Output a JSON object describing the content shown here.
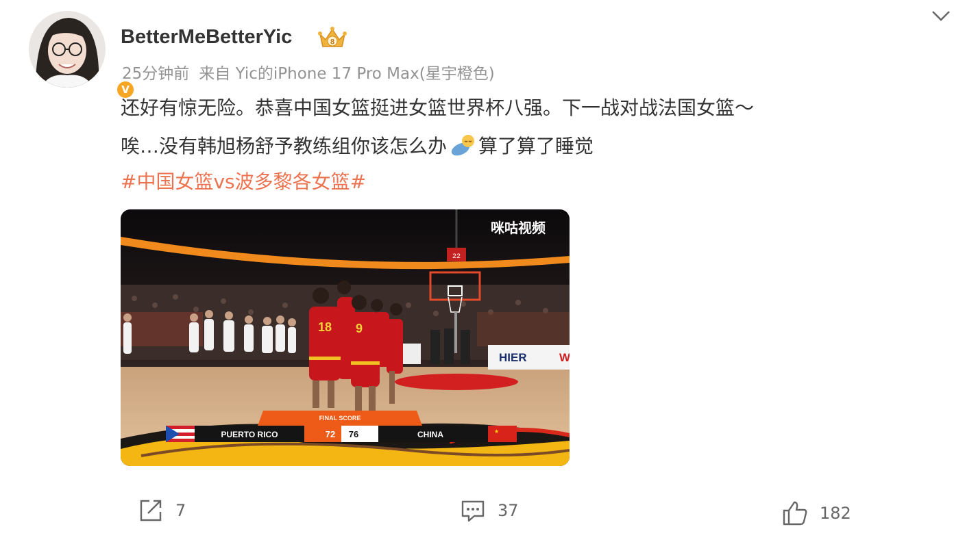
{
  "post": {
    "username": "BetterMeBetterYic",
    "time": "25分钟前",
    "source": "来自 Yic的iPhone 17 Pro Max(星宇橙色)",
    "text_line1": "还好有惊无险。恭喜中国女篮挺进女篮世界杯八强。下一战对战法国女篮～",
    "text_line2_a": "唉…没有韩旭杨舒予教练组你该怎么办",
    "text_line2_b": "算了算了睡觉",
    "topic": "#中国女篮vs波多黎各女篮#"
  },
  "badges": {
    "verified_icon": "verified-v-icon",
    "verified_label": "V",
    "crown_icon": "crown-level-icon",
    "crown_level": "8"
  },
  "emoji": {
    "name": "sleep-emoji-icon"
  },
  "media": {
    "watermark": "咪咕视频",
    "scoreboard": {
      "title": "FINAL SCORE",
      "team_left": "PUERTO RICO",
      "score_left": "72",
      "score_right": "76",
      "team_right": "CHINA"
    },
    "jersey_numbers": [
      "18",
      "9"
    ],
    "sponsor": "HIER",
    "sponsor_partial": "W",
    "shot_clock": "22"
  },
  "actions": {
    "repost_count": "7",
    "comment_count": "37",
    "like_count": "182"
  },
  "colors": {
    "topic": "#eb7350",
    "meta": "#939393",
    "verified": "#f6a623"
  }
}
